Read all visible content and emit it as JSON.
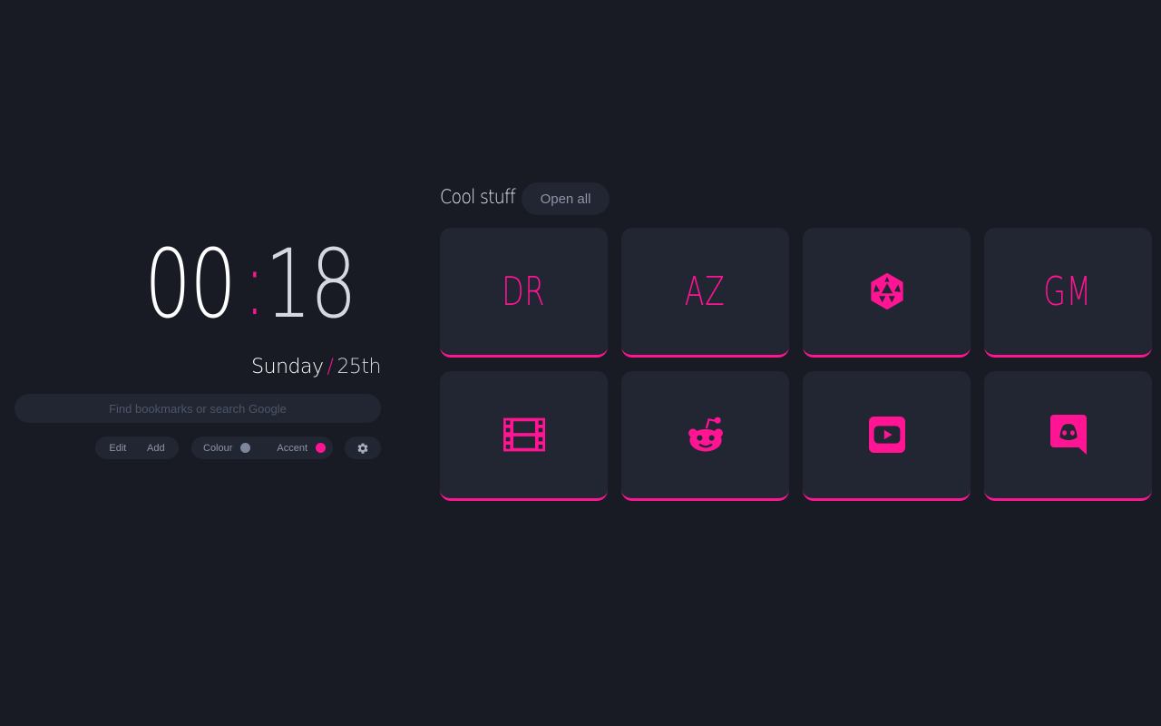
{
  "clock": {
    "hours": "00",
    "separator": ":",
    "minutes": "18"
  },
  "date": {
    "day": "Sunday",
    "slash": "/",
    "num": "25th"
  },
  "search": {
    "placeholder": "Find bookmarks or search Google"
  },
  "controls": {
    "edit_label": "Edit",
    "add_label": "Add",
    "colour_label": "Colour",
    "accent_label": "Accent",
    "colour_swatch": "#7d869c",
    "accent_swatch": "#ff1493",
    "settings_icon": "gear-icon"
  },
  "group": {
    "title": "Cool stuff",
    "open_all_label": "Open all"
  },
  "bookmarks": [
    {
      "text": "DR",
      "icon": ""
    },
    {
      "text": "AZ",
      "icon": ""
    },
    {
      "text": "",
      "icon": "d20-dice-icon"
    },
    {
      "text": "GM",
      "icon": ""
    },
    {
      "text": "",
      "icon": "film-icon"
    },
    {
      "text": "",
      "icon": "reddit-icon"
    },
    {
      "text": "",
      "icon": "youtube-icon"
    },
    {
      "text": "",
      "icon": "discord-icon"
    }
  ],
  "colors": {
    "background": "#181b23",
    "surface": "#212632",
    "accent": "#ff1493"
  }
}
